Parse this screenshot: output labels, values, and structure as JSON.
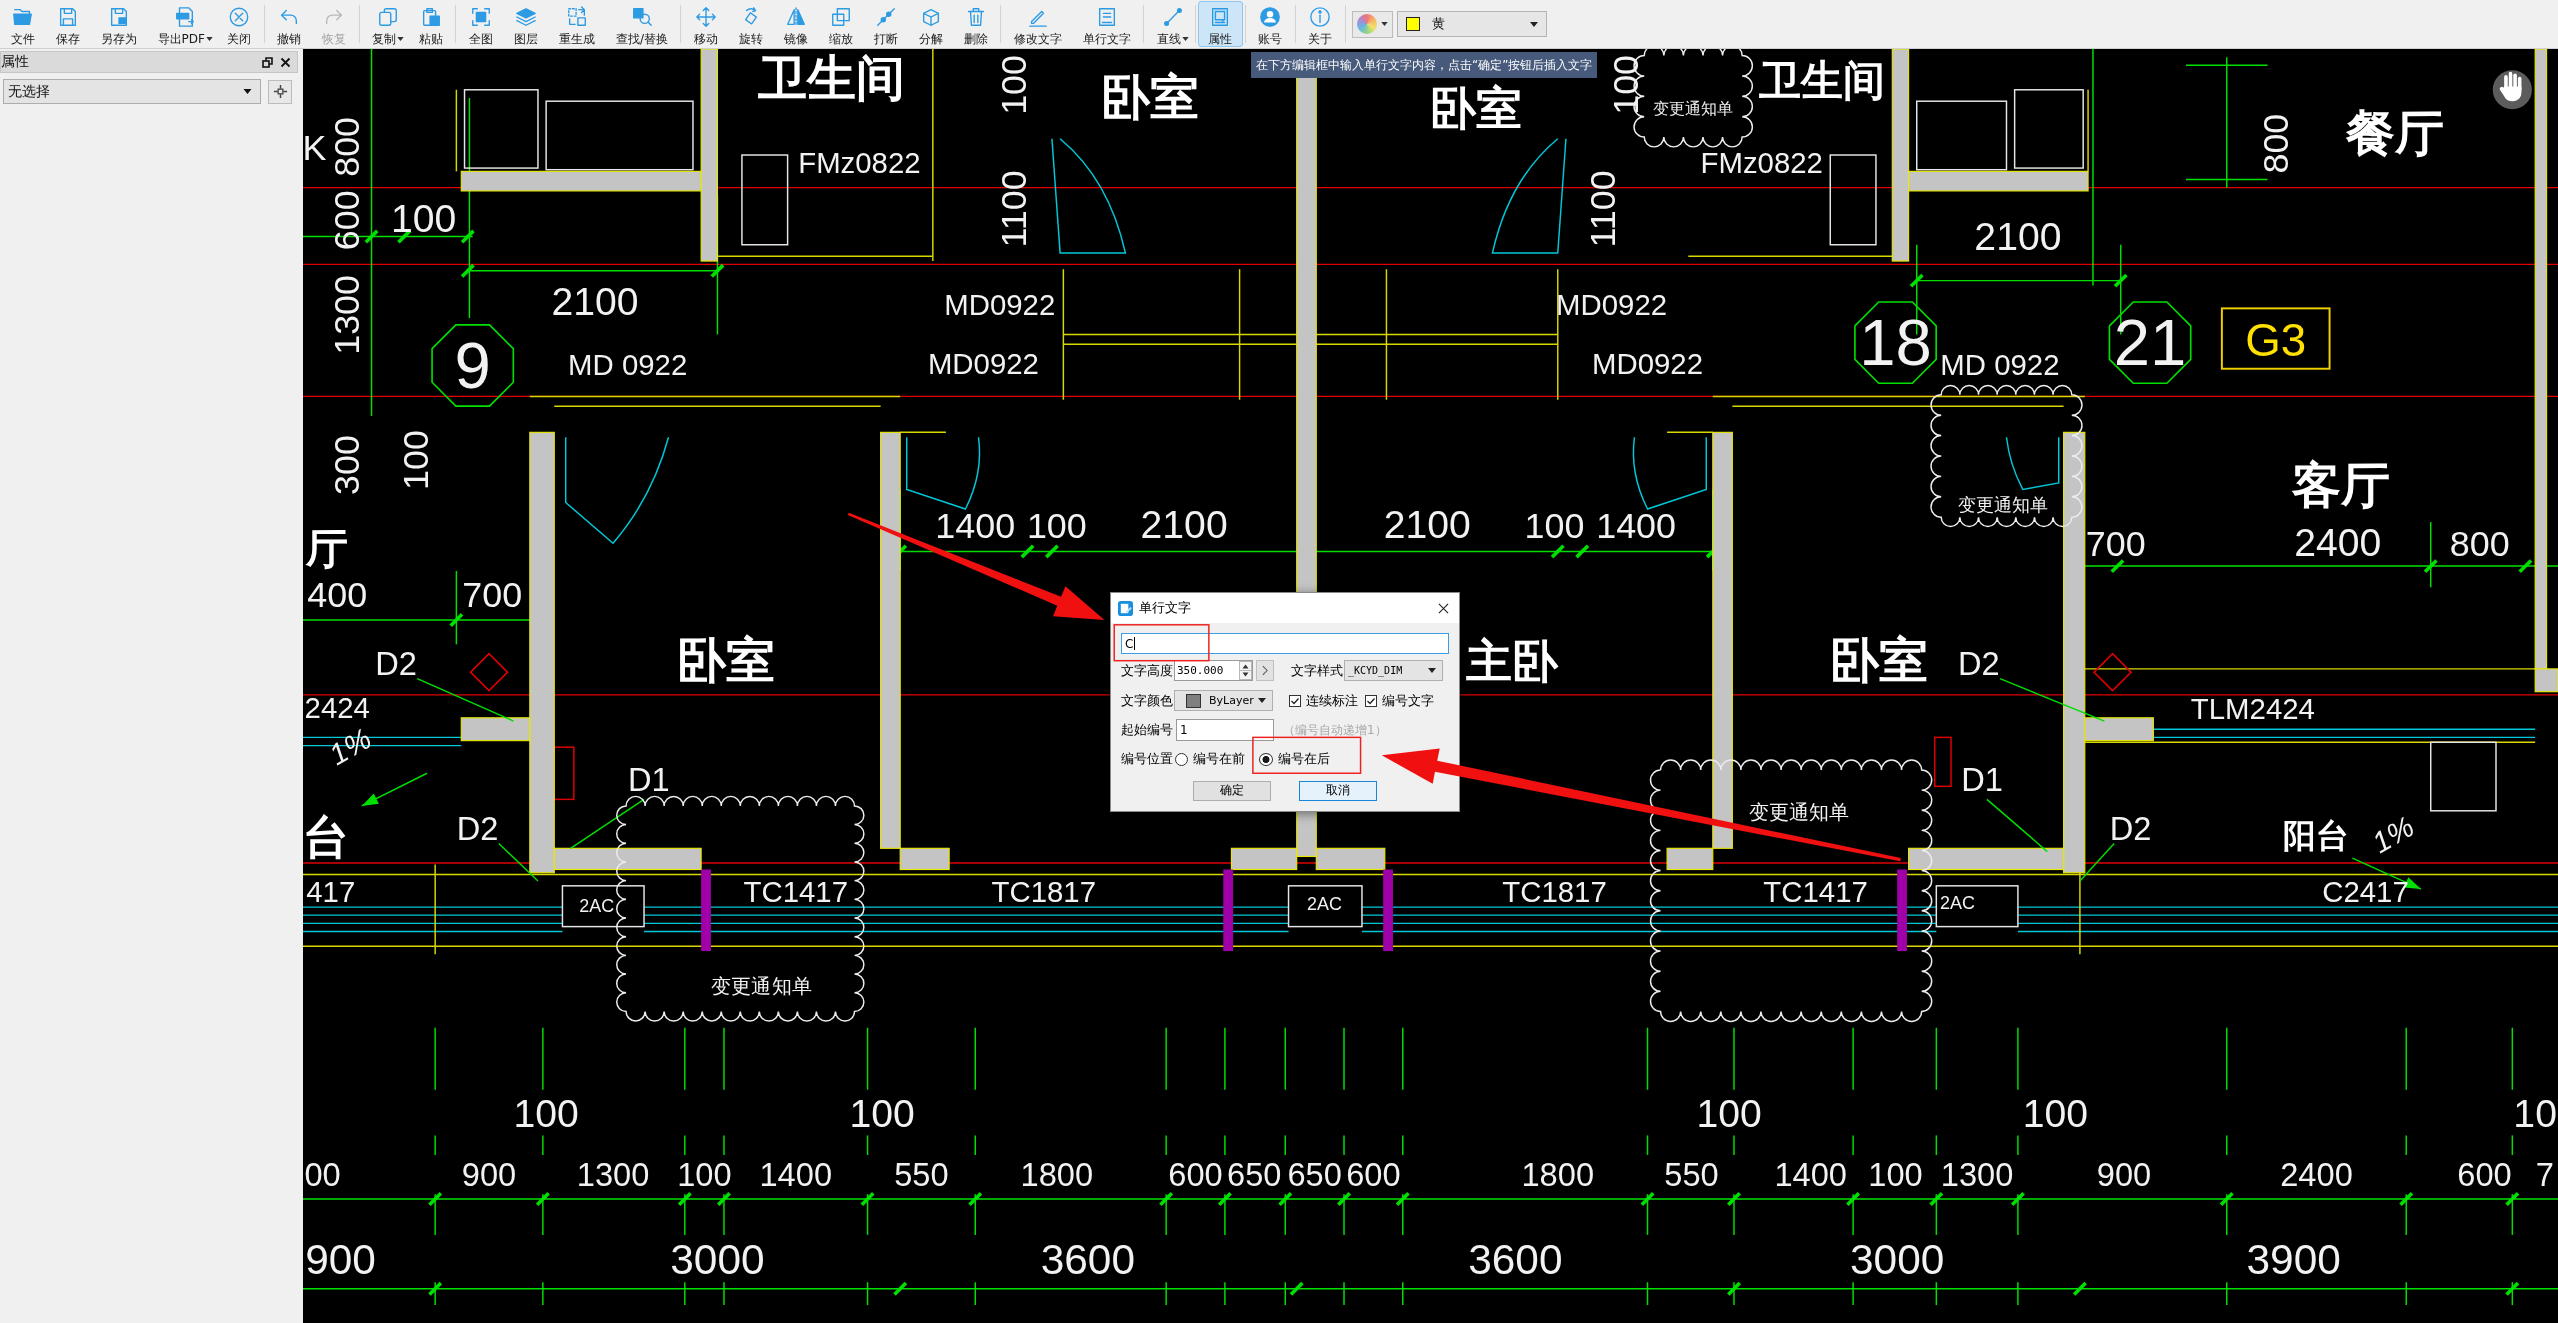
{
  "toolbar": {
    "groups": [
      [
        {
          "label": "文件",
          "selected": false,
          "disabled": false,
          "dropdown": false
        },
        {
          "label": "保存",
          "selected": false,
          "disabled": false,
          "dropdown": false
        },
        {
          "label": "另存为",
          "selected": false,
          "disabled": false,
          "dropdown": false
        },
        {
          "label": "导出PDF",
          "selected": false,
          "disabled": false,
          "dropdown": true
        },
        {
          "label": "关闭",
          "selected": false,
          "disabled": false,
          "dropdown": false
        }
      ],
      [
        {
          "label": "撤销",
          "selected": false,
          "disabled": false,
          "dropdown": false
        },
        {
          "label": "恢复",
          "selected": false,
          "disabled": true,
          "dropdown": false
        }
      ],
      [
        {
          "label": "复制",
          "selected": false,
          "disabled": false,
          "dropdown": true
        },
        {
          "label": "粘贴",
          "selected": false,
          "disabled": false,
          "dropdown": false
        }
      ],
      [
        {
          "label": "全图",
          "selected": false,
          "disabled": false,
          "dropdown": false
        },
        {
          "label": "图层",
          "selected": false,
          "disabled": false,
          "dropdown": false
        },
        {
          "label": "重生成",
          "selected": false,
          "disabled": false,
          "dropdown": false
        },
        {
          "label": "查找/替换",
          "selected": false,
          "disabled": false,
          "dropdown": false
        }
      ],
      [
        {
          "label": "移动",
          "selected": false,
          "disabled": false,
          "dropdown": false
        },
        {
          "label": "旋转",
          "selected": false,
          "disabled": false,
          "dropdown": false
        },
        {
          "label": "镜像",
          "selected": false,
          "disabled": false,
          "dropdown": false
        },
        {
          "label": "缩放",
          "selected": false,
          "disabled": false,
          "dropdown": false
        },
        {
          "label": "打断",
          "selected": false,
          "disabled": false,
          "dropdown": false
        },
        {
          "label": "分解",
          "selected": false,
          "disabled": false,
          "dropdown": false
        },
        {
          "label": "删除",
          "selected": false,
          "disabled": false,
          "dropdown": false
        }
      ],
      [
        {
          "label": "修改文字",
          "selected": false,
          "disabled": false,
          "dropdown": false
        },
        {
          "label": "单行文字",
          "selected": false,
          "disabled": false,
          "dropdown": false
        }
      ],
      [
        {
          "label": "直线",
          "selected": false,
          "disabled": false,
          "dropdown": true
        }
      ],
      [
        {
          "label": "属性",
          "selected": true,
          "disabled": false,
          "dropdown": false
        }
      ],
      [
        {
          "label": "账号",
          "selected": false,
          "disabled": false,
          "dropdown": false
        }
      ],
      [
        {
          "label": "关于",
          "selected": false,
          "disabled": false,
          "dropdown": false
        }
      ]
    ],
    "color_select": {
      "value": "黄",
      "color": "#ffff00"
    }
  },
  "tooltip": "在下方编辑框中输入单行文字内容，点击“确定”按钮后插入文字",
  "sidebar": {
    "title": "属性",
    "selection": "无选择"
  },
  "drawing": {
    "room_labels": [
      "卫生间",
      "卧室",
      "卧室",
      "卫生间",
      "餐厅",
      "客厅",
      "厅",
      "卧室",
      "主卧",
      "卧室",
      "台",
      "阳台"
    ],
    "door_window_labels": [
      "K",
      "FMz0822",
      "FMz0822",
      "MD0922",
      "MD0922",
      "MD 0922",
      "MD0922",
      "MD0922",
      "MD 0922",
      "D2",
      "D2",
      "2424",
      "TLM2424",
      "D1",
      "D1",
      "D2",
      "D2",
      "417",
      "2AC",
      "TC1417",
      "TC1817",
      "2AC",
      "TC1817",
      "TC1417",
      "2AC",
      "C2417"
    ],
    "dimension_labels": [
      "100",
      "2100",
      "2100",
      "1400",
      "100",
      "2100",
      "2100",
      "100",
      "1400",
      "700",
      "2400",
      "800",
      "400",
      "700",
      "100",
      "100",
      "100",
      "100",
      "10",
      "00",
      "900",
      "1300",
      "100",
      "1400",
      "550",
      "1800",
      "600",
      "650",
      "650",
      "600",
      "1800",
      "550",
      "1400",
      "100",
      "1300",
      "900",
      "2400",
      "600",
      "7",
      "900",
      "3000",
      "3600",
      "3600",
      "3000",
      "3900"
    ],
    "vertical_dimension_labels": [
      "100",
      "100",
      "800",
      "800",
      "600",
      "1100",
      "1100",
      "1300",
      "300",
      "100"
    ],
    "axis_tags": [
      "9",
      "18",
      "21"
    ],
    "grid_tag": "G3",
    "revision_clouds": [
      {
        "label": "变更通知单"
      },
      {
        "label": "变更通知单"
      },
      {
        "label": "变更通知单"
      },
      {
        "label": "变更通知单"
      }
    ],
    "slope_labels": [
      "1%",
      "1%"
    ]
  },
  "dialog": {
    "title": "单行文字",
    "text_value": "C",
    "height": {
      "label": "文字高度",
      "value": "350.000"
    },
    "style": {
      "label": "文字样式",
      "value": "_KCYD_DIM"
    },
    "color": {
      "label": "文字颜色",
      "value": "ByLayer",
      "color": "#808080"
    },
    "checkboxes": [
      {
        "label": "连续标注",
        "checked": true
      },
      {
        "label": "编号文字",
        "checked": true
      }
    ],
    "start_number": {
      "label": "起始编号",
      "value": "1",
      "hint": "（编号自动递增1）"
    },
    "number_position": {
      "label": "编号位置",
      "options": [
        {
          "label": "编号在前",
          "selected": false
        },
        {
          "label": "编号在后",
          "selected": true
        }
      ]
    },
    "buttons": [
      {
        "label": "确定",
        "focused": false
      },
      {
        "label": "取消",
        "focused": true
      }
    ]
  }
}
